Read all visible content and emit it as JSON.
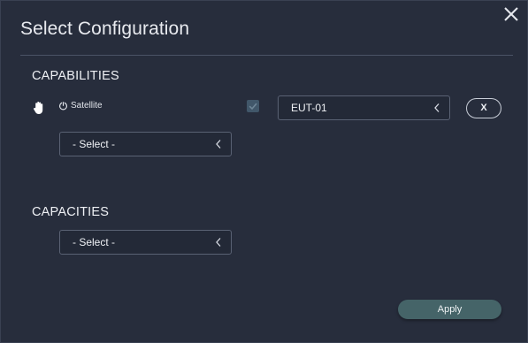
{
  "dialog": {
    "title": "Select Configuration",
    "close_icon": "close-x-icon"
  },
  "capabilities": {
    "heading": "CAPABILITIES",
    "item": {
      "drag_icon": "hand-icon",
      "status_icon": "power-icon",
      "label": "Satellite",
      "checked": true,
      "selected_value": "EUT-01",
      "remove_label": "X"
    },
    "select": {
      "value": "- Select -"
    }
  },
  "capacities": {
    "heading": "CAPACITIES",
    "select": {
      "value": "- Select -"
    }
  },
  "footer": {
    "apply_label": "Apply"
  },
  "colors": {
    "background": "#272d3c",
    "divider": "#4b5366",
    "checkbox": "#41576a",
    "apply_button": "#456468"
  }
}
